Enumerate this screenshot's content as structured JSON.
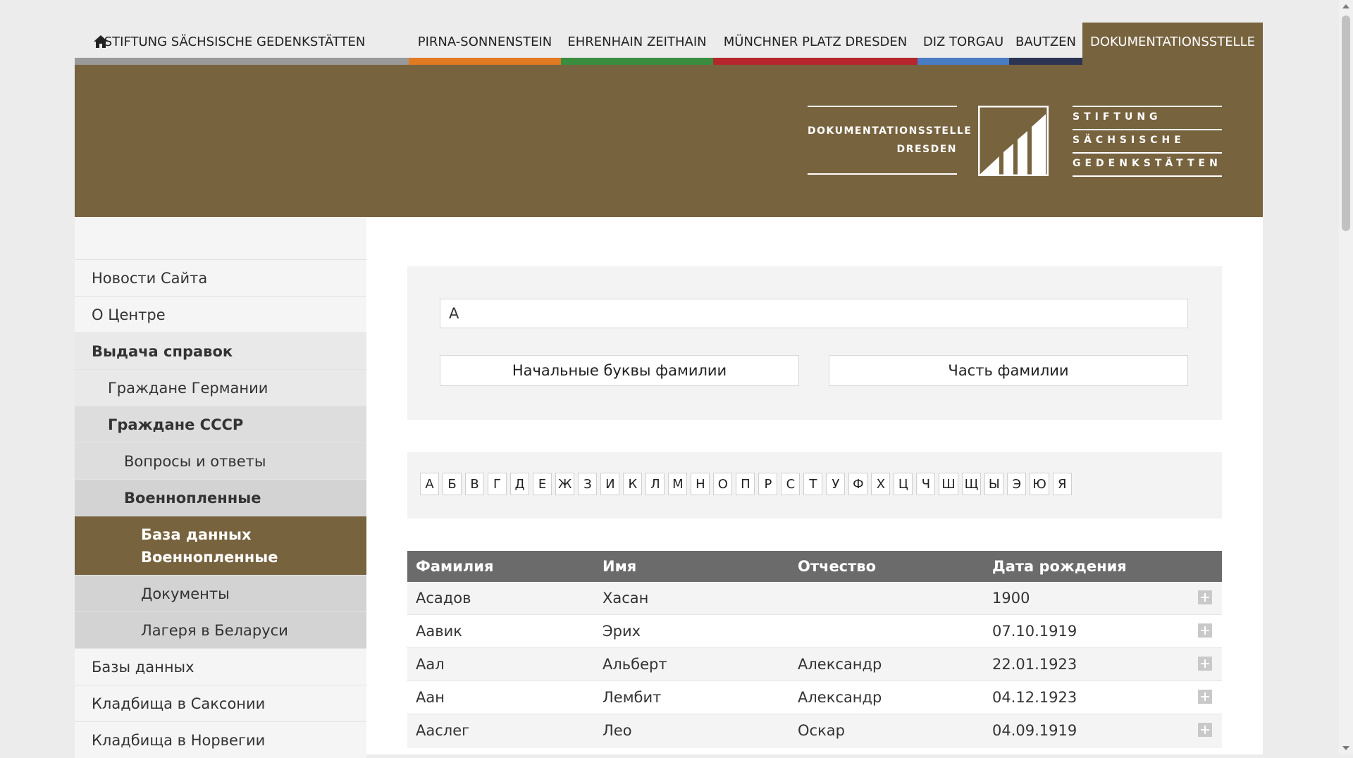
{
  "nav": {
    "home_icon": "home-icon",
    "items": [
      {
        "label": "STIFTUNG SÄCHSISCHE GEDENKSTÄTTEN",
        "color": "#9a9a9a"
      },
      {
        "label": "PIRNA-SONNENSTEIN",
        "color": "#e07b22"
      },
      {
        "label": "EHRENHAIN ZEITHAIN",
        "color": "#3a8c3f"
      },
      {
        "label": "MÜNCHNER PLATZ DRESDEN",
        "color": "#b5272d"
      },
      {
        "label": "DIZ TORGAU",
        "color": "#4a7cc4"
      },
      {
        "label": "BAUTZEN",
        "color": "#2b3553"
      },
      {
        "label": "DOKUMENTATIONSSTELLE",
        "color": "#78633f"
      }
    ]
  },
  "header": {
    "logo_left": [
      "DOKUMENTATIONSSTELLE",
      "DRESDEN"
    ],
    "logo_right": [
      "STIFTUNG",
      "SÄCHSISCHE",
      "GEDENKSTÄTTEN"
    ],
    "brand_color": "#78633f"
  },
  "sidebar": {
    "items": [
      {
        "label": "Новости Сайта"
      },
      {
        "label": "О Центре"
      },
      {
        "label": "Выдача справок"
      },
      {
        "label": "Граждане Германии"
      },
      {
        "label": "Граждане СССР"
      },
      {
        "label": "Вопросы и ответы"
      },
      {
        "label": "Военнопленные"
      },
      {
        "label": "База данных Военнопленные"
      },
      {
        "label": "Документы"
      },
      {
        "label": "Лагеря в Беларуси"
      },
      {
        "label": "Базы данных"
      },
      {
        "label": "Кладбища в Саксонии"
      },
      {
        "label": "Кладбища в Норвегии"
      }
    ]
  },
  "search": {
    "value": "А",
    "btn_prefix": "Начальные буквы фамилии",
    "btn_part": "Часть фамилии"
  },
  "alphabet": [
    "А",
    "Б",
    "В",
    "Г",
    "Д",
    "Е",
    "Ж",
    "З",
    "И",
    "К",
    "Л",
    "М",
    "Н",
    "О",
    "П",
    "Р",
    "С",
    "Т",
    "У",
    "Ф",
    "Х",
    "Ц",
    "Ч",
    "Ш",
    "Щ",
    "Ы",
    "Э",
    "Ю",
    "Я"
  ],
  "table": {
    "headers": [
      "Фамилия",
      "Имя",
      "Отчество",
      "Дата рождения"
    ],
    "rows": [
      [
        "Асадов",
        "Хасан",
        "",
        "1900"
      ],
      [
        "Аавик",
        "Эрих",
        "",
        "07.10.1919"
      ],
      [
        "Аал",
        "Альберт",
        "Александр",
        "22.01.1923"
      ],
      [
        "Аан",
        "Лембит",
        "Александр",
        "04.12.1923"
      ],
      [
        "Аaслег",
        "Лео",
        "Оскар",
        "04.09.1919"
      ]
    ]
  }
}
